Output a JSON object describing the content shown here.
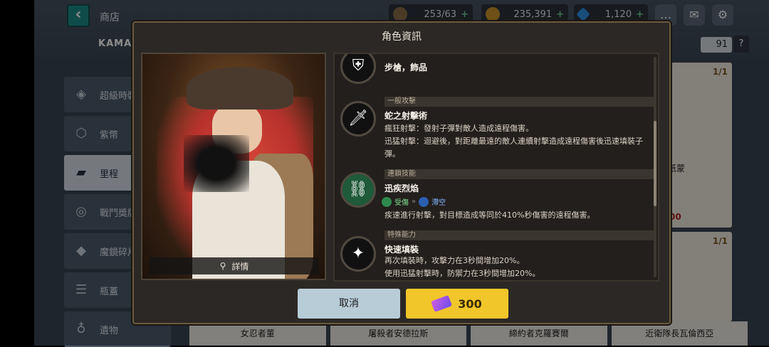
{
  "topbar": {
    "title": "商店",
    "brand": "KAMAZ",
    "stamina": "253/63",
    "gold": "235,391",
    "gems": "1,120",
    "plus": "+"
  },
  "sidebar": {
    "items": [
      {
        "label": "超級時裝",
        "icon": "mask-icon"
      },
      {
        "label": "紫幣",
        "icon": "hexagon-coin-icon"
      },
      {
        "label": "里程",
        "icon": "ticket-icon"
      },
      {
        "label": "戰鬥獎牌",
        "icon": "medal-icon"
      },
      {
        "label": "魔鏡碎片",
        "icon": "shard-icon"
      },
      {
        "label": "瓶蓋",
        "icon": "bottlecap-icon"
      },
      {
        "label": "遺物",
        "icon": "relic-icon"
      }
    ]
  },
  "right": {
    "count": "91",
    "help": "?",
    "card1_count": "1/1",
    "card1_name": "紙蒙",
    "card1_price": "00",
    "card2_count": "1/1"
  },
  "bottom_names": [
    "女忍者董",
    "屠殺者安德拉斯",
    "締約者克羅賽爾",
    "近衛隊長瓦倫西亞"
  ],
  "modal": {
    "title": "角色資訊",
    "detail": "詳情",
    "sections": [
      {
        "icon": "rifle-accessory-icon",
        "name": "步槍，飾品"
      },
      {
        "category": "一般攻擊",
        "icon": "dagger-icon",
        "name": "蛇之射擊術",
        "lines": [
          "瘋狂射擊：發射子彈對敵人造成遠程傷害。",
          "迅猛射擊：迴避後，對距離最遠的敵人連續射擊造成遠程傷害後迅速填裝子彈。"
        ]
      },
      {
        "category": "連鎖技能",
        "icon": "chain-skill-icon",
        "name": "迅疾烈焰",
        "tag1": "受傷",
        "tag2": "滯空",
        "lines": [
          "疾速進行射擊，對目標造成等同於410%秒傷害的遠程傷害。"
        ]
      },
      {
        "category": "特殊能力",
        "icon": "sparkle-icon",
        "name": "快速填裝",
        "lines": [
          "再次填裝時，攻擊力在3秒間增加20%。",
          "使用迅猛射擊時，防禦力在3秒間增加20%。"
        ]
      }
    ],
    "cancel": "取消",
    "price": "300"
  },
  "colors": {
    "accent": "#f1c62a",
    "cancel": "#b8ccd8",
    "teal": "#1c8a86"
  }
}
